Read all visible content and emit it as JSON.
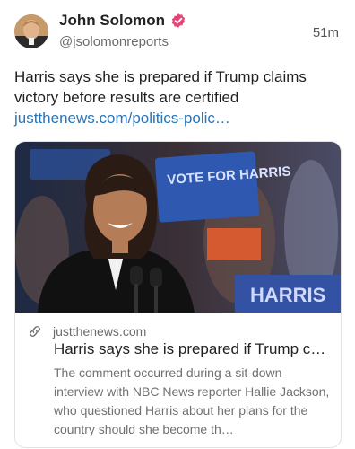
{
  "post": {
    "author_name": "John Solomon",
    "author_handle": "@jsolomonreports",
    "timestamp": "51m",
    "text": "Harris says she is prepared if Trump claims victory before results are certified",
    "link_text": "justthenews.com/politics-polic…"
  },
  "card": {
    "domain": "justthenews.com",
    "title": "Harris says she is prepared if Trump c…",
    "description": "The comment occurred during a sit-down interview with NBC News reporter Hallie Jackson, who questioned Harris about her plans for the country should she become th…",
    "image_sign_texts": [
      "VOTE FOR HARRIS",
      "HARRIS"
    ]
  },
  "icons": {
    "verified": "verified-badge-icon",
    "link": "link-icon"
  },
  "colors": {
    "link": "#2a74b8",
    "verified_badge": "#e8457a",
    "card_border": "#e3e3e3"
  }
}
